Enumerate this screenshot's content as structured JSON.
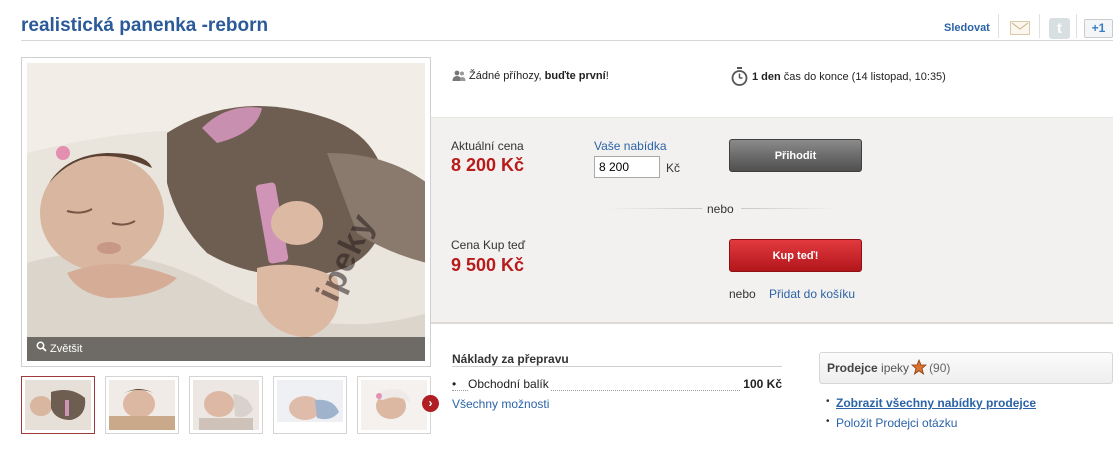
{
  "header": {
    "title": "realistická panenka -reborn",
    "follow_label": "Sledovat",
    "gplus_label": "+1",
    "twitter_glyph": "t"
  },
  "gallery": {
    "zoom_label": "Zvětšit",
    "watermark": "ipeky",
    "thumbnail_count": 5,
    "active_thumbnail": 1
  },
  "auction": {
    "bids_prefix": "Žádné příhozy, ",
    "bids_emph": "buďte první",
    "bids_suffix": "!",
    "time_left": "1 den",
    "time_rest": " čas do konce (14 listopad, 10:35)"
  },
  "bid": {
    "current_label": "Aktuální cena",
    "current_price": "8 200 Kč",
    "your_bid_label": "Vaše nabídka",
    "bid_value": "8 200",
    "currency": "Kč",
    "button": "Přihodit"
  },
  "divider_label": "nebo",
  "buy_now": {
    "label": "Cena Kup teď",
    "price": "9 500 Kč",
    "button": "Kup teď!",
    "or_label": "nebo",
    "cart_link": "Přidat do košíku"
  },
  "shipping": {
    "title": "Náklady za přepravu",
    "items": [
      {
        "name": "Obchodní balík",
        "price": "100 Kč"
      }
    ],
    "all_options": "Všechny možnosti"
  },
  "seller": {
    "label": "Prodejce",
    "name": "ipeky",
    "rating": "(90)",
    "link_all": "Zobrazit všechny nabídky prodejce",
    "link_ask": "Položit Prodejci otázku"
  },
  "colors": {
    "title_blue": "#2b5a98",
    "price_red": "#b71c1c",
    "link_blue": "#2b63a7",
    "panel_bg": "#f3f1ef"
  },
  "icons": [
    "mail-icon",
    "twitter-icon",
    "gplus-icon",
    "bidders-icon",
    "clock-icon",
    "magnifier-icon",
    "star-icon",
    "chevron-right-icon"
  ]
}
